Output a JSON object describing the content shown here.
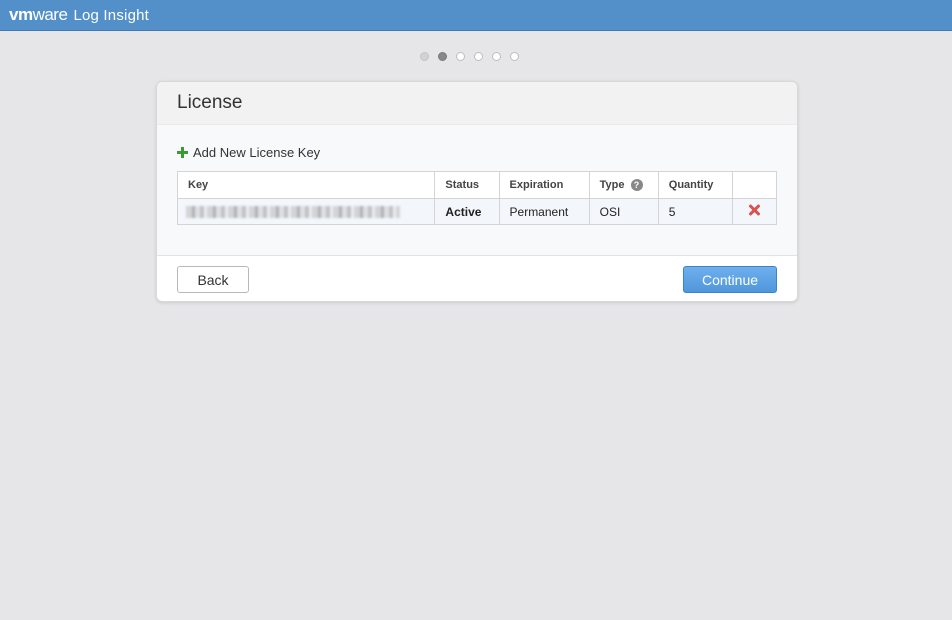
{
  "app": {
    "brand_vm": "vm",
    "brand_ware": "ware",
    "product": "Log Insight"
  },
  "wizard": {
    "step_count": 6,
    "current_step": 2
  },
  "card": {
    "title": "License",
    "add_link": "Add New License Key",
    "columns": {
      "key": "Key",
      "status": "Status",
      "expiration": "Expiration",
      "type": "Type",
      "quantity": "Quantity"
    },
    "rows": [
      {
        "key": "",
        "status": "Active",
        "expiration": "Permanent",
        "type": "OSI",
        "quantity": "5"
      }
    ]
  },
  "footer": {
    "back_label": "Back",
    "continue_label": "Continue"
  },
  "colors": {
    "topbar": "#5390c9",
    "status_active": "#5a9a2e",
    "delete": "#d9534f",
    "add": "#3a9a34",
    "primary_button": "#4f97dc"
  },
  "icons": [
    "plus-icon",
    "help-icon",
    "delete-icon"
  ]
}
